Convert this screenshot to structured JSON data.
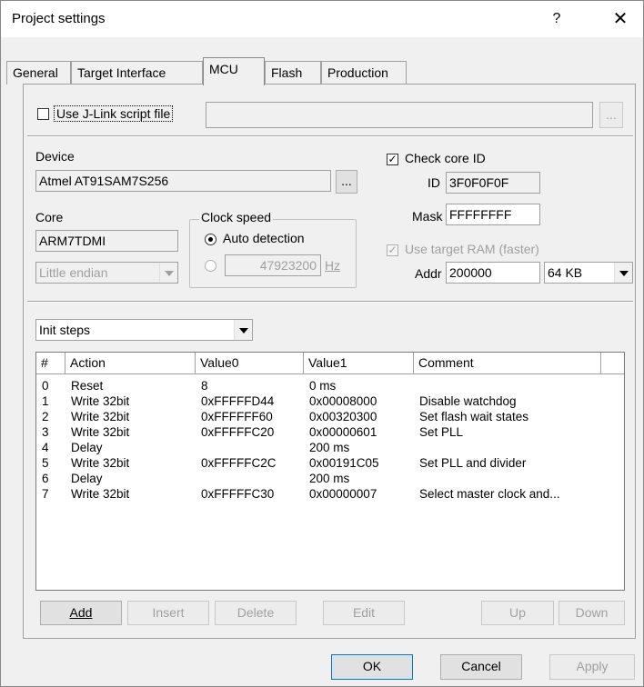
{
  "window": {
    "title": "Project settings",
    "help_glyph": "?",
    "close_glyph": "✕"
  },
  "tabs": [
    "General",
    "Target Interface",
    "MCU",
    "Flash",
    "Production"
  ],
  "active_tab": "MCU",
  "jlink_script": {
    "label": "Use J-Link script file",
    "checked": false,
    "value": "",
    "browse_label": "..."
  },
  "device": {
    "label": "Device",
    "value": "Atmel AT91SAM7S256",
    "browse_label": "..."
  },
  "core": {
    "label": "Core",
    "value": "ARM7TDMI",
    "endian": "Little endian"
  },
  "clock_speed": {
    "title": "Clock speed",
    "auto_label": "Auto detection",
    "auto_selected": true,
    "manual_value": "47923200",
    "unit": "Hz"
  },
  "core_id": {
    "check_label": "Check core ID",
    "checked": true,
    "id_label": "ID",
    "id_value": "3F0F0F0F",
    "mask_label": "Mask",
    "mask_value": "FFFFFFFF"
  },
  "target_ram": {
    "label": "Use target RAM (faster)",
    "checked": true,
    "disabled": true,
    "addr_label": "Addr",
    "addr_value": "200000",
    "size_value": "64 KB"
  },
  "steps_select": {
    "value": "Init steps"
  },
  "table": {
    "columns": [
      "#",
      "Action",
      "Value0",
      "Value1",
      "Comment"
    ],
    "rows": [
      {
        "num": "0",
        "action": "Reset",
        "value0": "8",
        "value1": "0 ms",
        "comment": ""
      },
      {
        "num": "1",
        "action": "Write 32bit",
        "value0": "0xFFFFFD44",
        "value1": "0x00008000",
        "comment": "Disable watchdog"
      },
      {
        "num": "2",
        "action": "Write 32bit",
        "value0": "0xFFFFFF60",
        "value1": "0x00320300",
        "comment": "Set flash wait states"
      },
      {
        "num": "3",
        "action": "Write 32bit",
        "value0": "0xFFFFFC20",
        "value1": "0x00000601",
        "comment": "Set PLL"
      },
      {
        "num": "4",
        "action": "Delay",
        "value0": "",
        "value1": "200 ms",
        "comment": ""
      },
      {
        "num": "5",
        "action": "Write 32bit",
        "value0": "0xFFFFFC2C",
        "value1": "0x00191C05",
        "comment": "Set PLL and divider"
      },
      {
        "num": "6",
        "action": "Delay",
        "value0": "",
        "value1": "200 ms",
        "comment": ""
      },
      {
        "num": "7",
        "action": "Write 32bit",
        "value0": "0xFFFFFC30",
        "value1": "0x00000007",
        "comment": "Select master clock and..."
      }
    ]
  },
  "step_buttons": {
    "add": "Add",
    "insert": "Insert",
    "delete": "Delete",
    "edit": "Edit",
    "up": "Up",
    "down": "Down"
  },
  "dialog_buttons": {
    "ok": "OK",
    "cancel": "Cancel",
    "apply": "Apply"
  },
  "colors": {
    "dialog_bg": "#f0f0f0",
    "default_button_border": "#0078d7",
    "disabled_text": "#a0a0a0"
  }
}
